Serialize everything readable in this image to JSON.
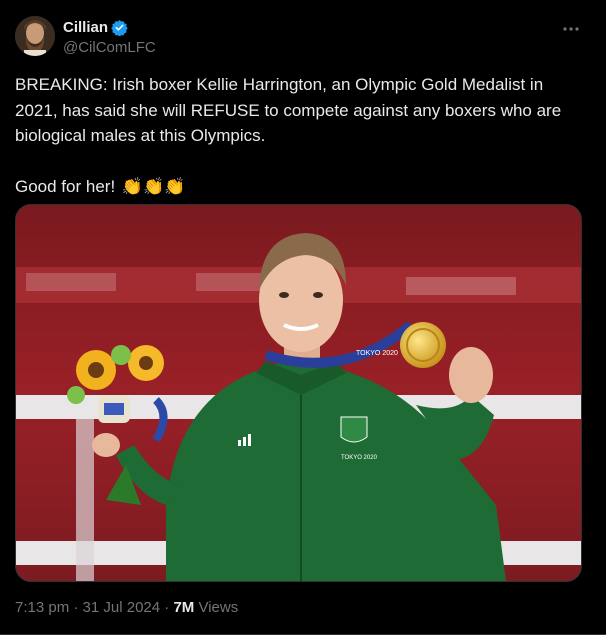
{
  "author": {
    "display_name": "Cillian",
    "handle": "@CilComLFC",
    "verified": true,
    "verified_color": "#1d9bf0"
  },
  "tweet": {
    "paragraph_1": "BREAKING: Irish boxer Kellie Harrington, an Olympic Gold Medalist in 2021, has said she will REFUSE to compete against any boxers who are biological males at this Olympics.",
    "paragraph_2": "Good for her!",
    "emoji": "👏👏👏"
  },
  "media": {
    "medal_ribbon_text": "TOKYO 2020",
    "jacket_logo_text": "TOKYO 2020"
  },
  "meta": {
    "time": "7:13 pm",
    "separator": "·",
    "date": "31 Jul 2024",
    "views_count": "7M",
    "views_label": "Views"
  },
  "icons": {
    "more": "more-icon",
    "verified": "verified-badge-icon"
  },
  "colors": {
    "background": "#000000",
    "text": "#e7e9ea",
    "muted": "#71767b",
    "photo_background": "#8a1c22",
    "jacket": "#1f6b35"
  }
}
